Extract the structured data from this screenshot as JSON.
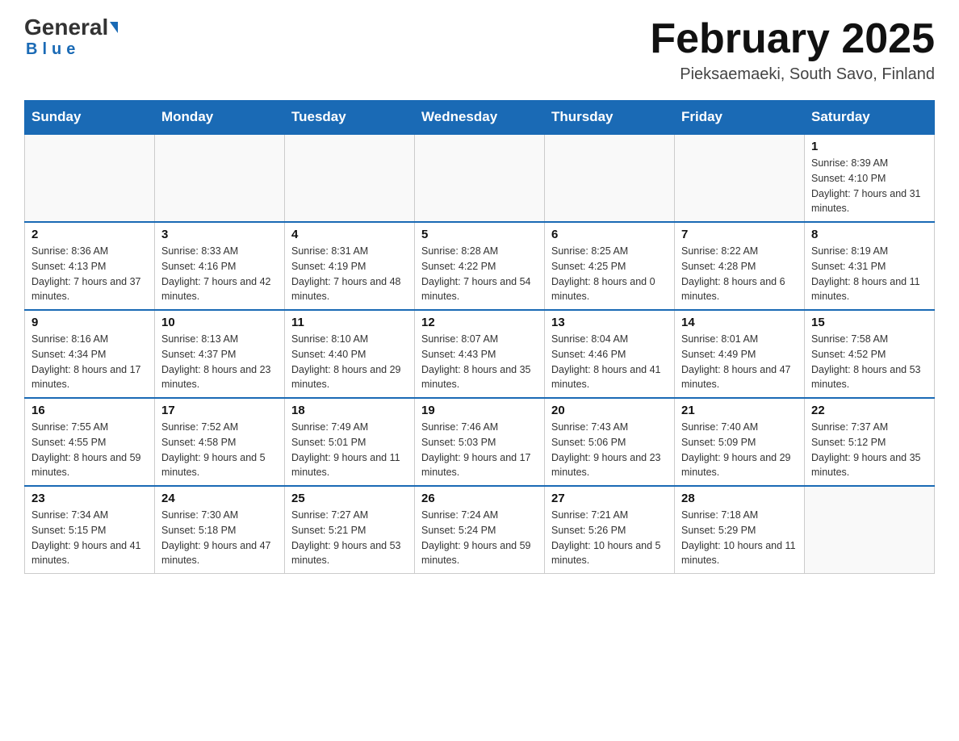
{
  "header": {
    "logo_general": "General",
    "logo_blue": "Blue",
    "month_title": "February 2025",
    "location": "Pieksaemaeki, South Savo, Finland"
  },
  "weekdays": [
    "Sunday",
    "Monday",
    "Tuesday",
    "Wednesday",
    "Thursday",
    "Friday",
    "Saturday"
  ],
  "weeks": [
    [
      {
        "day": "",
        "sunrise": "",
        "sunset": "",
        "daylight": ""
      },
      {
        "day": "",
        "sunrise": "",
        "sunset": "",
        "daylight": ""
      },
      {
        "day": "",
        "sunrise": "",
        "sunset": "",
        "daylight": ""
      },
      {
        "day": "",
        "sunrise": "",
        "sunset": "",
        "daylight": ""
      },
      {
        "day": "",
        "sunrise": "",
        "sunset": "",
        "daylight": ""
      },
      {
        "day": "",
        "sunrise": "",
        "sunset": "",
        "daylight": ""
      },
      {
        "day": "1",
        "sunrise": "Sunrise: 8:39 AM",
        "sunset": "Sunset: 4:10 PM",
        "daylight": "Daylight: 7 hours and 31 minutes."
      }
    ],
    [
      {
        "day": "2",
        "sunrise": "Sunrise: 8:36 AM",
        "sunset": "Sunset: 4:13 PM",
        "daylight": "Daylight: 7 hours and 37 minutes."
      },
      {
        "day": "3",
        "sunrise": "Sunrise: 8:33 AM",
        "sunset": "Sunset: 4:16 PM",
        "daylight": "Daylight: 7 hours and 42 minutes."
      },
      {
        "day": "4",
        "sunrise": "Sunrise: 8:31 AM",
        "sunset": "Sunset: 4:19 PM",
        "daylight": "Daylight: 7 hours and 48 minutes."
      },
      {
        "day": "5",
        "sunrise": "Sunrise: 8:28 AM",
        "sunset": "Sunset: 4:22 PM",
        "daylight": "Daylight: 7 hours and 54 minutes."
      },
      {
        "day": "6",
        "sunrise": "Sunrise: 8:25 AM",
        "sunset": "Sunset: 4:25 PM",
        "daylight": "Daylight: 8 hours and 0 minutes."
      },
      {
        "day": "7",
        "sunrise": "Sunrise: 8:22 AM",
        "sunset": "Sunset: 4:28 PM",
        "daylight": "Daylight: 8 hours and 6 minutes."
      },
      {
        "day": "8",
        "sunrise": "Sunrise: 8:19 AM",
        "sunset": "Sunset: 4:31 PM",
        "daylight": "Daylight: 8 hours and 11 minutes."
      }
    ],
    [
      {
        "day": "9",
        "sunrise": "Sunrise: 8:16 AM",
        "sunset": "Sunset: 4:34 PM",
        "daylight": "Daylight: 8 hours and 17 minutes."
      },
      {
        "day": "10",
        "sunrise": "Sunrise: 8:13 AM",
        "sunset": "Sunset: 4:37 PM",
        "daylight": "Daylight: 8 hours and 23 minutes."
      },
      {
        "day": "11",
        "sunrise": "Sunrise: 8:10 AM",
        "sunset": "Sunset: 4:40 PM",
        "daylight": "Daylight: 8 hours and 29 minutes."
      },
      {
        "day": "12",
        "sunrise": "Sunrise: 8:07 AM",
        "sunset": "Sunset: 4:43 PM",
        "daylight": "Daylight: 8 hours and 35 minutes."
      },
      {
        "day": "13",
        "sunrise": "Sunrise: 8:04 AM",
        "sunset": "Sunset: 4:46 PM",
        "daylight": "Daylight: 8 hours and 41 minutes."
      },
      {
        "day": "14",
        "sunrise": "Sunrise: 8:01 AM",
        "sunset": "Sunset: 4:49 PM",
        "daylight": "Daylight: 8 hours and 47 minutes."
      },
      {
        "day": "15",
        "sunrise": "Sunrise: 7:58 AM",
        "sunset": "Sunset: 4:52 PM",
        "daylight": "Daylight: 8 hours and 53 minutes."
      }
    ],
    [
      {
        "day": "16",
        "sunrise": "Sunrise: 7:55 AM",
        "sunset": "Sunset: 4:55 PM",
        "daylight": "Daylight: 8 hours and 59 minutes."
      },
      {
        "day": "17",
        "sunrise": "Sunrise: 7:52 AM",
        "sunset": "Sunset: 4:58 PM",
        "daylight": "Daylight: 9 hours and 5 minutes."
      },
      {
        "day": "18",
        "sunrise": "Sunrise: 7:49 AM",
        "sunset": "Sunset: 5:01 PM",
        "daylight": "Daylight: 9 hours and 11 minutes."
      },
      {
        "day": "19",
        "sunrise": "Sunrise: 7:46 AM",
        "sunset": "Sunset: 5:03 PM",
        "daylight": "Daylight: 9 hours and 17 minutes."
      },
      {
        "day": "20",
        "sunrise": "Sunrise: 7:43 AM",
        "sunset": "Sunset: 5:06 PM",
        "daylight": "Daylight: 9 hours and 23 minutes."
      },
      {
        "day": "21",
        "sunrise": "Sunrise: 7:40 AM",
        "sunset": "Sunset: 5:09 PM",
        "daylight": "Daylight: 9 hours and 29 minutes."
      },
      {
        "day": "22",
        "sunrise": "Sunrise: 7:37 AM",
        "sunset": "Sunset: 5:12 PM",
        "daylight": "Daylight: 9 hours and 35 minutes."
      }
    ],
    [
      {
        "day": "23",
        "sunrise": "Sunrise: 7:34 AM",
        "sunset": "Sunset: 5:15 PM",
        "daylight": "Daylight: 9 hours and 41 minutes."
      },
      {
        "day": "24",
        "sunrise": "Sunrise: 7:30 AM",
        "sunset": "Sunset: 5:18 PM",
        "daylight": "Daylight: 9 hours and 47 minutes."
      },
      {
        "day": "25",
        "sunrise": "Sunrise: 7:27 AM",
        "sunset": "Sunset: 5:21 PM",
        "daylight": "Daylight: 9 hours and 53 minutes."
      },
      {
        "day": "26",
        "sunrise": "Sunrise: 7:24 AM",
        "sunset": "Sunset: 5:24 PM",
        "daylight": "Daylight: 9 hours and 59 minutes."
      },
      {
        "day": "27",
        "sunrise": "Sunrise: 7:21 AM",
        "sunset": "Sunset: 5:26 PM",
        "daylight": "Daylight: 10 hours and 5 minutes."
      },
      {
        "day": "28",
        "sunrise": "Sunrise: 7:18 AM",
        "sunset": "Sunset: 5:29 PM",
        "daylight": "Daylight: 10 hours and 11 minutes."
      },
      {
        "day": "",
        "sunrise": "",
        "sunset": "",
        "daylight": ""
      }
    ]
  ]
}
